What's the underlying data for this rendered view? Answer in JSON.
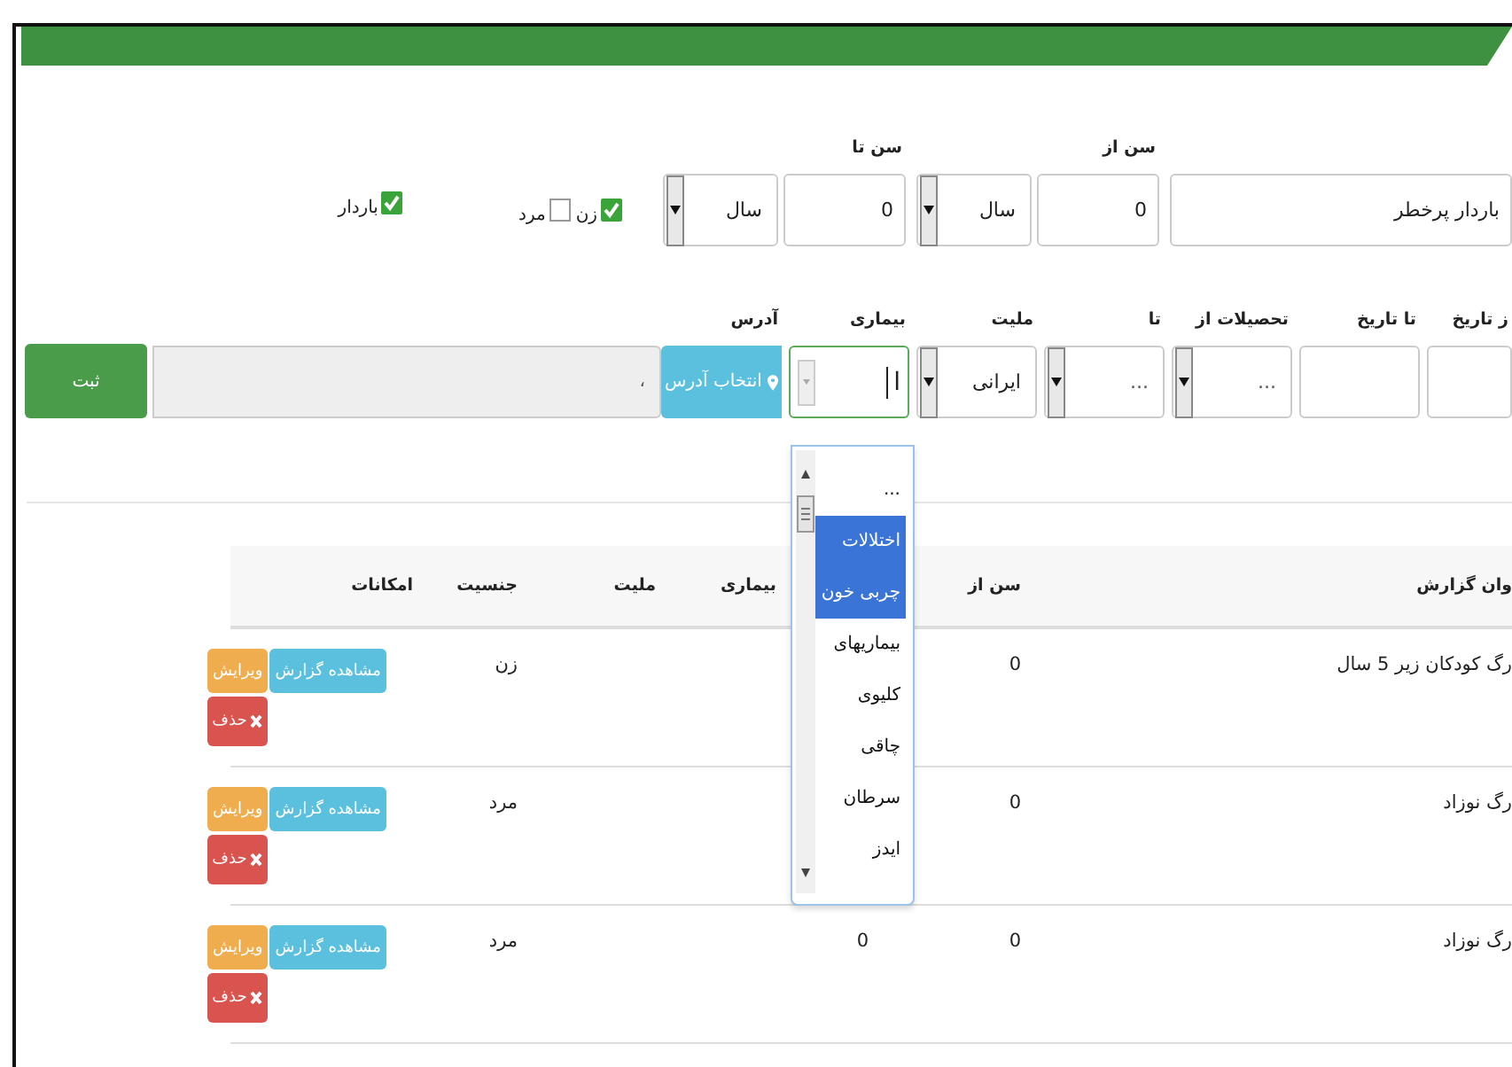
{
  "filters": {
    "risk_group": {
      "value": "باردار پرخطر"
    },
    "age_from": {
      "label": "سن از",
      "value": "0",
      "unit": "سال"
    },
    "age_to": {
      "label": "سن تا",
      "value": "0",
      "unit": "سال"
    },
    "gender": [
      {
        "label": "زن",
        "checked": true
      },
      {
        "label": "مرد",
        "checked": false
      }
    ],
    "pregnancy": {
      "label": "باردار",
      "checked": true
    },
    "fields": [
      {
        "kind": "input",
        "label": "ز تاریخ"
      },
      {
        "kind": "input",
        "label": "تا تاریخ"
      },
      {
        "kind": "select",
        "label": "تحصیلات از",
        "value": "..."
      },
      {
        "kind": "select",
        "label": "تا",
        "value": "..."
      },
      {
        "kind": "select",
        "label": "ملیت",
        "value": "ایرانی"
      },
      {
        "kind": "combo",
        "label": "بیماری",
        "value": "ا"
      }
    ],
    "address": {
      "label": "آدرس",
      "button": "انتخاب آدرس",
      "value": "،"
    },
    "submit": "ثبت"
  },
  "disease_dropdown": {
    "options": [
      {
        "label": "...",
        "selected": false
      },
      {
        "label": "اختلالات چربی خون",
        "selected": true
      },
      {
        "label": "بیماریهای کلیوی",
        "selected": false
      },
      {
        "label": "چاقی",
        "selected": false
      },
      {
        "label": "سرطان",
        "selected": false
      },
      {
        "label": "ایدز",
        "selected": false
      }
    ]
  },
  "table": {
    "columns": [
      {
        "label": "وان گزارش"
      },
      {
        "label": "سن از"
      },
      {},
      {
        "label": "بیماری"
      },
      {
        "label": "ملیت"
      },
      {
        "label": "جنسیت"
      },
      {
        "label": "امکانات"
      }
    ],
    "rows": [
      {
        "cells": [
          "رگ کودکان زیر 5 سال",
          "0",
          null,
          null,
          null,
          "زن"
        ],
        "actions": {
          "view": "مشاهده گزارش",
          "edit": "ویرایش",
          "delete": "حذف"
        }
      },
      {
        "cells": [
          "رگ نوزاد",
          "0",
          null,
          null,
          null,
          "مرد"
        ],
        "actions": {
          "view": "مشاهده گزارش",
          "edit": "ویرایش",
          "delete": "حذف"
        }
      },
      {
        "cells": [
          "رگ نوزاد",
          "0",
          "0",
          null,
          null,
          "مرد"
        ],
        "actions": {
          "view": "مشاهده گزارش",
          "edit": "ویرایش",
          "delete": "حذف"
        }
      }
    ]
  }
}
